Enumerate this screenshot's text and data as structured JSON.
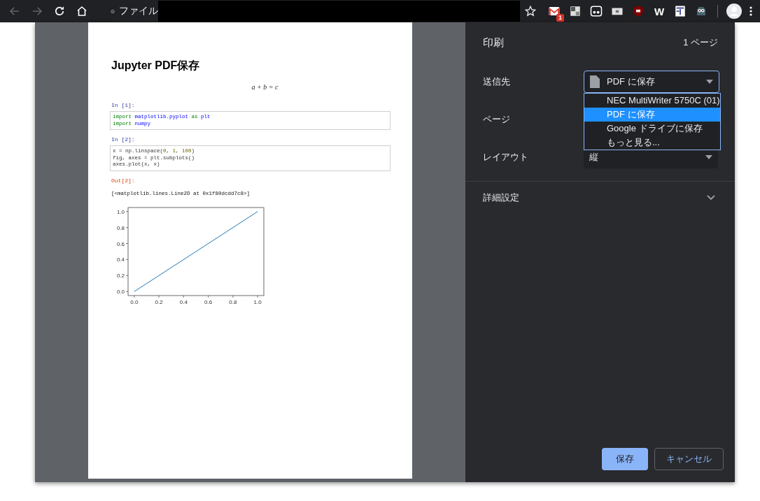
{
  "browser": {
    "address": {
      "info_label": "ファイル"
    },
    "extensions": [
      {
        "kind": "mail",
        "badge": "1"
      },
      {
        "kind": "grid"
      },
      {
        "kind": "glasses"
      },
      {
        "kind": "card"
      },
      {
        "kind": "shield"
      },
      {
        "kind": "letter",
        "text": "W"
      },
      {
        "kind": "note"
      },
      {
        "kind": "owl"
      }
    ]
  },
  "document": {
    "title": "Jupyter PDF保存",
    "math": "a + b = c",
    "cells": [
      {
        "kind": "input",
        "prompt": "In [1]:",
        "lines": [
          [
            {
              "text": "import ",
              "kind": "keyword"
            },
            {
              "text": "matplotlib.pyplot ",
              "kind": "name"
            },
            {
              "text": "as ",
              "kind": "keyword"
            },
            {
              "text": "plt",
              "kind": "name"
            }
          ],
          [
            {
              "text": "import ",
              "kind": "keyword"
            },
            {
              "text": "numpy",
              "kind": "name"
            }
          ]
        ]
      },
      {
        "kind": "input",
        "prompt": "In [2]:",
        "lines": [
          [
            {
              "text": "x = np.linspace(",
              "kind": "plain"
            },
            {
              "text": "0, 1, 100",
              "kind": "number"
            },
            {
              "text": ")",
              "kind": "plain"
            }
          ],
          [
            {
              "text": "fig, axes = plt.subplots()",
              "kind": "plain"
            }
          ],
          [
            {
              "text": "axes.plot(x, x)",
              "kind": "plain"
            }
          ]
        ]
      },
      {
        "kind": "output",
        "prompt": "Out[2]:",
        "text": "[<matplotlib.lines.Line2D at 0x1f80dcdd7c8>]"
      },
      {
        "kind": "chart",
        "chart_data": {
          "type": "line",
          "x": [
            0,
            1
          ],
          "series": [
            {
              "color": "#1f77b4",
              "values": [
                0,
                1
              ]
            }
          ],
          "xlim": [
            -0.05,
            1.05
          ],
          "ylim": [
            -0.05,
            1.05
          ],
          "xticks": [
            {
              "value": 0,
              "label": "0.0"
            },
            {
              "value": 0.2,
              "label": "0.2"
            },
            {
              "value": 0.4,
              "label": "0.4"
            },
            {
              "value": 0.6,
              "label": "0.6"
            },
            {
              "value": 0.8,
              "label": "0.8"
            },
            {
              "value": 1,
              "label": "1.0"
            }
          ],
          "yticks": [
            {
              "value": 0,
              "label": "0.0"
            },
            {
              "value": 0.2,
              "label": "0.2"
            },
            {
              "value": 0.4,
              "label": "0.4"
            },
            {
              "value": 0.6,
              "label": "0.6"
            },
            {
              "value": 0.8,
              "label": "0.8"
            },
            {
              "value": 1,
              "label": "1.0"
            }
          ]
        }
      }
    ]
  },
  "print_panel": {
    "title": "印刷",
    "page_count": "1 ページ",
    "rows": [
      {
        "label": "送信先",
        "kind": "destination",
        "value": "PDF に保存"
      },
      {
        "label": "ページ",
        "kind": "covered"
      },
      {
        "label": "レイアウト",
        "kind": "select",
        "value": "縦"
      }
    ],
    "dropdown": [
      {
        "label": "NEC MultiWriter 5750C (01)",
        "selected": false
      },
      {
        "label": "PDF に保存",
        "selected": true
      },
      {
        "label": "Google ドライブに保存",
        "selected": false
      },
      {
        "label": "もっと見る...",
        "selected": false
      }
    ],
    "more_settings": {
      "label": "詳細設定",
      "expanded": false
    },
    "buttons": [
      {
        "label": "保存",
        "kind": "primary"
      },
      {
        "label": "キャンセル",
        "kind": "secondary"
      }
    ]
  }
}
